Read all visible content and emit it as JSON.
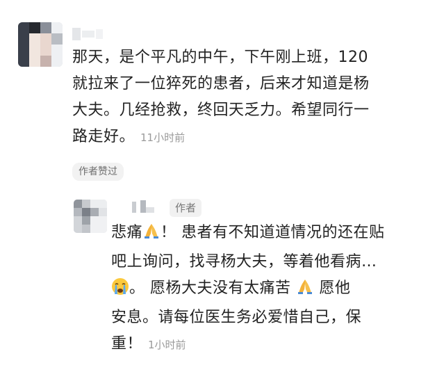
{
  "comment": {
    "username_obscured": "",
    "line1": "那天，是个平凡的中午，下午刚上班，120",
    "line2": "就拉来了一位猝死的患者，后来才知道是杨",
    "line3": "大夫。几经抢救，终回天乏力。希望同行一",
    "line4": "路走好。",
    "time": "11小时前",
    "liked_by_author": "作者赞过"
  },
  "reply": {
    "username_obscured": "",
    "author_badge": "作者",
    "segments": {
      "s1": "悲痛",
      "s2": "！ 患者有不知道道情况的还在贴",
      "s3": "吧上询问，找寻杨大夫，等着他看病…",
      "s4": "。 愿杨大夫没有太痛苦 ",
      "s5": " 愿他",
      "s6": "安息。请每位医生务必爱惜自己，保",
      "s7": "重！"
    },
    "time": "1小时前"
  },
  "icons": {
    "pray": "pray-emoji-icon",
    "crying": "crying-emoji-icon"
  },
  "colors": {
    "text": "#222222",
    "muted": "#9a9a9a",
    "chip_bg": "#f2f2f2"
  }
}
